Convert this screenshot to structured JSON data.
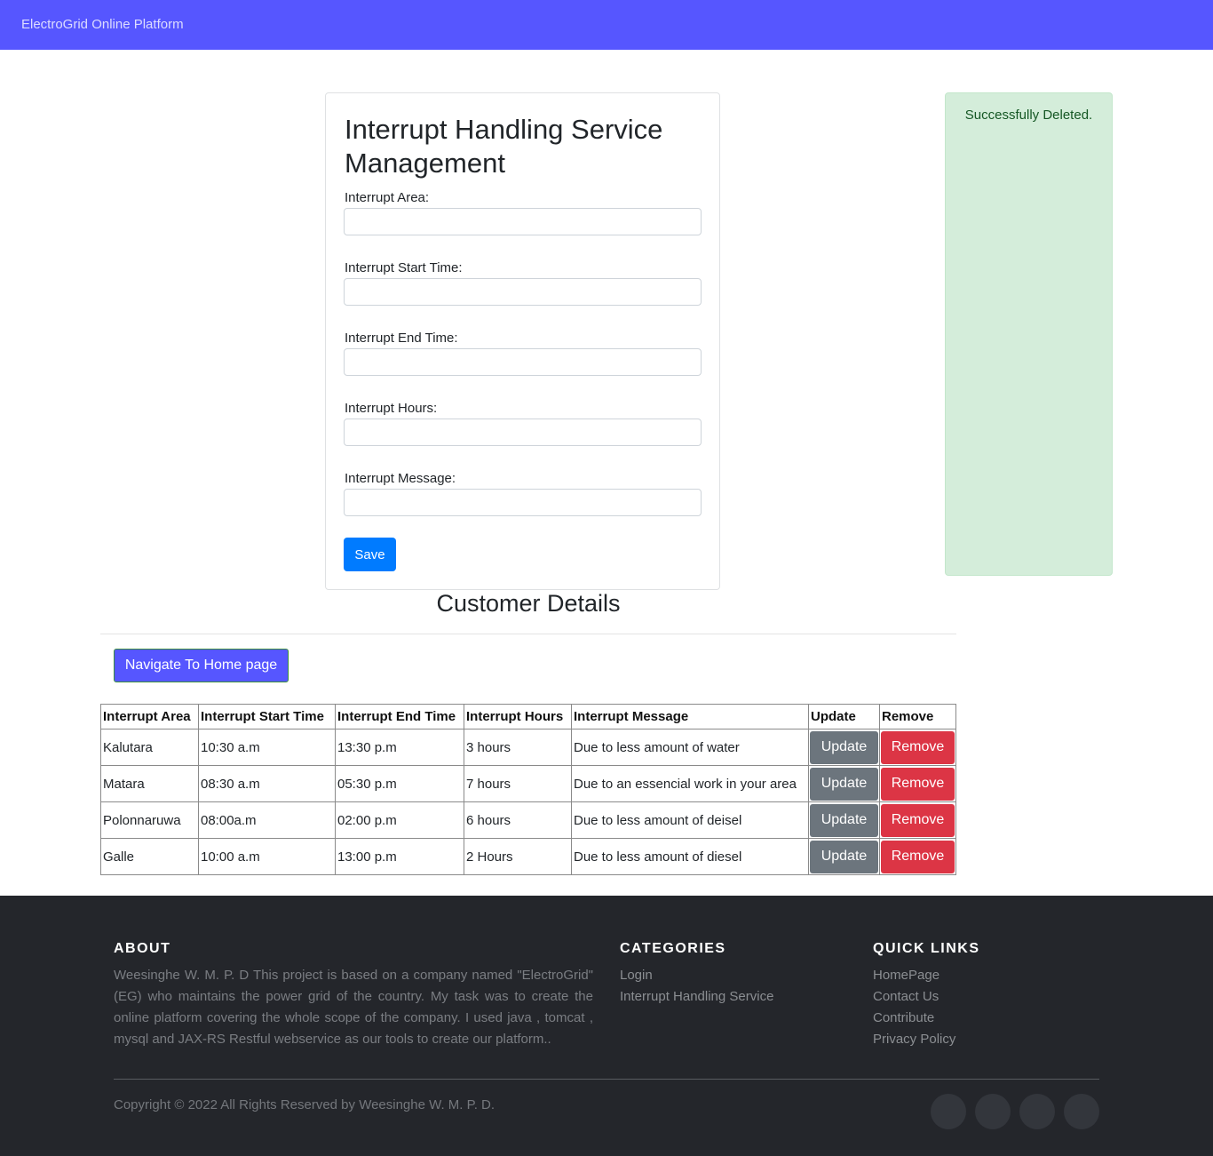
{
  "navbar": {
    "brand": "ElectroGrid Online Platform"
  },
  "form": {
    "title": "Interrupt Handling Service Management",
    "fields": [
      {
        "label": "Interrupt Area:",
        "value": "",
        "placeholder": ""
      },
      {
        "label": "Interrupt Start Time:",
        "value": "",
        "placeholder": ""
      },
      {
        "label": "Interrupt End Time:",
        "value": "",
        "placeholder": ""
      },
      {
        "label": "Interrupt Hours:",
        "value": "",
        "placeholder": ""
      },
      {
        "label": "Interrupt Message:",
        "value": "",
        "placeholder": ""
      }
    ],
    "save_label": "Save"
  },
  "alert": {
    "message": "Successfully Deleted.",
    "color": "#d4edda"
  },
  "section": {
    "title": "Customer Details",
    "home_button": "Navigate To Home page"
  },
  "table": {
    "headers": [
      "Interrupt Area",
      "Interrupt Start Time",
      "Interrupt End Time",
      "Interrupt Hours",
      "Interrupt Message",
      "Update",
      "Remove"
    ],
    "rows": [
      {
        "area": "Kalutara",
        "start": "10:30 a.m",
        "end": "13:30 p.m",
        "hours": "3 hours",
        "message": "Due to less amount of water"
      },
      {
        "area": "Matara",
        "start": "08:30 a.m",
        "end": "05:30 p.m",
        "hours": "7 hours",
        "message": "Due to an essencial work in your area"
      },
      {
        "area": "Polonnaruwa",
        "start": "08:00a.m",
        "end": "02:00 p.m",
        "hours": "6 hours",
        "message": "Due to less amount of deisel"
      },
      {
        "area": "Galle",
        "start": "10:00 a.m",
        "end": "13:00 p.m",
        "hours": "2 Hours",
        "message": "Due to less amount of diesel"
      }
    ],
    "update_label": "Update",
    "remove_label": "Remove"
  },
  "footer": {
    "about_heading": "ABOUT",
    "about_text": "Weesinghe W. M. P. D This project is based on a company named \"ElectroGrid\" (EG) who maintains the power grid of the country. My task was to create the online platform covering the whole scope of the company. I used java , tomcat , mysql and JAX-RS Restful webservice as our tools to create our platform..",
    "categories_heading": "CATEGORIES",
    "categories": [
      "Login",
      "Interrupt Handling Service"
    ],
    "quick_links_heading": "QUICK LINKS",
    "quick_links": [
      "HomePage",
      "Contact Us",
      "Contribute",
      "Privacy Policy"
    ],
    "copyright": "Copyright © 2022 All Rights Reserved by Weesinghe W. M. P. D.",
    "social_icons": [
      "social-icon-1",
      "social-icon-2",
      "social-icon-3",
      "social-icon-4"
    ]
  },
  "colors": {
    "navbar": "#5656ff",
    "primary": "#007bff",
    "secondary": "#6c757d",
    "danger": "#dc3545",
    "footer": "#24262b"
  }
}
